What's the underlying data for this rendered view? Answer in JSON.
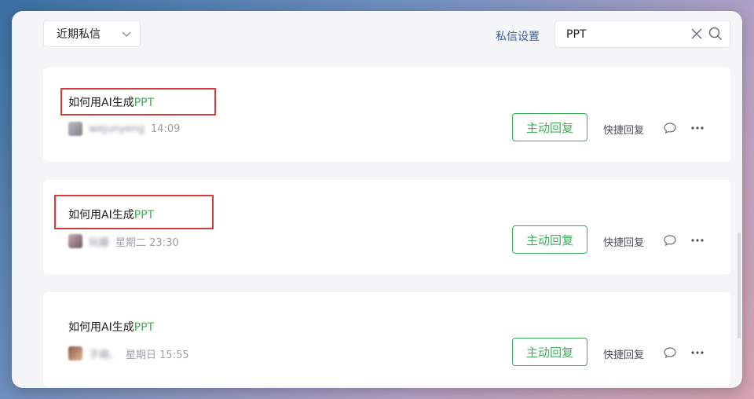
{
  "filter": {
    "selected": "近期私信"
  },
  "header": {
    "settings_label": "私信设置"
  },
  "search": {
    "value": "PPT",
    "placeholder": ""
  },
  "messages": [
    {
      "title_prefix": "如何用AI生成",
      "title_highlight": "PPT",
      "sender": "wejunyeng",
      "time": "14:09",
      "reply_label": "主动回复",
      "quick_reply_label": "快捷回复"
    },
    {
      "title_prefix": "如何用AI生成",
      "title_highlight": "PPT",
      "sender": "玩媛",
      "time": "星期二 23:30",
      "reply_label": "主动回复",
      "quick_reply_label": "快捷回复"
    },
    {
      "title_prefix": "如何用AI生成",
      "title_highlight": "PPT",
      "sender": "子萌、",
      "time": "星期日 15:55",
      "reply_label": "主动回复",
      "quick_reply_label": "快捷回复"
    }
  ],
  "colors": {
    "accent_green": "#3fae5b",
    "link_blue": "#3e5ea6",
    "highlight_box_red": "#d63a3a"
  },
  "icons": {
    "dropdown": "chevron-down-icon",
    "clear": "close-icon",
    "search": "search-icon",
    "chat": "chat-bubble-icon",
    "more": "more-icon"
  }
}
